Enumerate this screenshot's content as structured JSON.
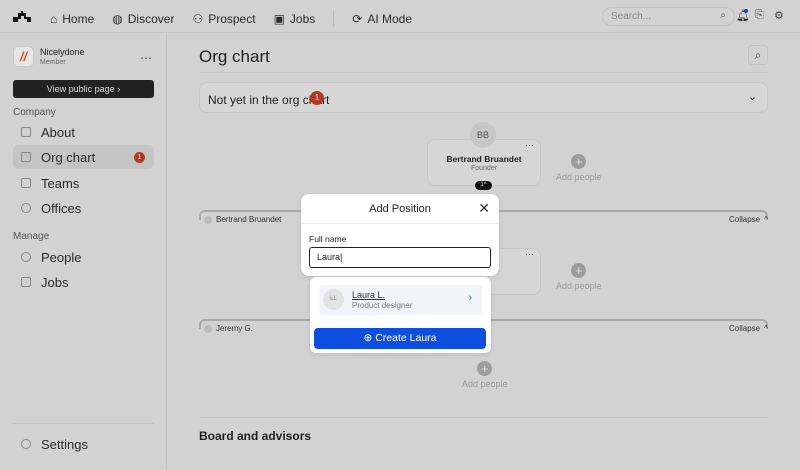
{
  "nav": {
    "items": [
      {
        "label": "Home",
        "icon": "home-icon"
      },
      {
        "label": "Discover",
        "icon": "globe-icon"
      },
      {
        "label": "Prospect",
        "icon": "users-icon"
      },
      {
        "label": "Jobs",
        "icon": "briefcase-icon"
      },
      {
        "label": "AI Mode",
        "icon": "ai-icon"
      }
    ],
    "search_placeholder": "Search..."
  },
  "sidebar": {
    "org_name": "Nicelydone",
    "org_role": "Member",
    "view_public": "View public page",
    "company_label": "Company",
    "company_items": [
      {
        "label": "About"
      },
      {
        "label": "Org chart",
        "badge": "1"
      },
      {
        "label": "Teams"
      },
      {
        "label": "Offices"
      }
    ],
    "manage_label": "Manage",
    "manage_items": [
      {
        "label": "People"
      },
      {
        "label": "Jobs"
      }
    ],
    "settings": "Settings"
  },
  "main": {
    "title": "Org chart",
    "not_yet": "Not yet in the org chart",
    "not_yet_count": "1",
    "root": {
      "initials": "BB",
      "name": "Bertrand Bruandet",
      "role": "Founder",
      "children_toggle": "1"
    },
    "add_people": "Add people",
    "groups": [
      {
        "initials": "BB",
        "name": "Bertrand Bruandet",
        "collapse": "Collapse"
      },
      {
        "initials": "JG",
        "name": "Jeremy G.",
        "collapse": "Collapse"
      }
    ],
    "board": "Board and advisors"
  },
  "modal": {
    "title": "Add Position",
    "field_label": "Full name",
    "field_value": "Laura",
    "suggestion": {
      "initials": "LL",
      "name": "Laura L.",
      "role": "Product designer"
    },
    "create_label": "Create Laura"
  },
  "colors": {
    "accent": "#0f4fe0",
    "badge": "#b33a26"
  }
}
